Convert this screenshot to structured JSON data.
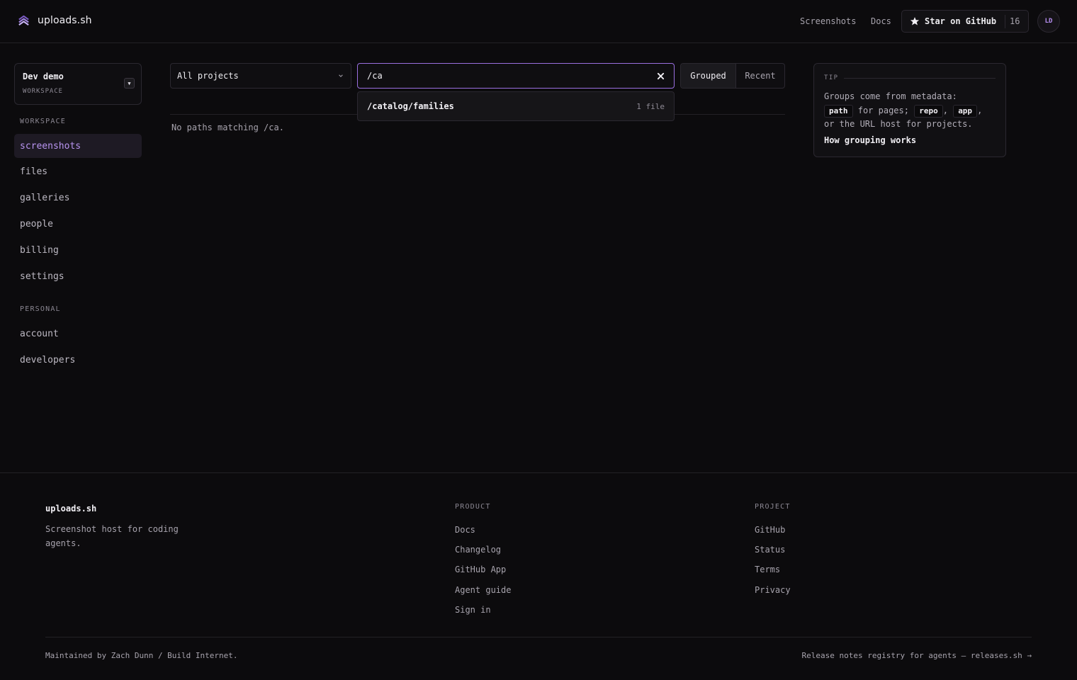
{
  "header": {
    "brand": "uploads.sh",
    "nav": {
      "screenshots": "Screenshots",
      "docs": "Docs"
    },
    "github": {
      "label": "Star on GitHub",
      "count": "16"
    },
    "avatar_initials": "LD"
  },
  "sidebar": {
    "workspace": {
      "name": "Dev demo",
      "label": "WORKSPACE"
    },
    "sections": {
      "workspace_title": "WORKSPACE",
      "personal_title": "PERSONAL"
    },
    "workspace_items": [
      {
        "label": "screenshots",
        "active": true
      },
      {
        "label": "files"
      },
      {
        "label": "galleries"
      },
      {
        "label": "people"
      },
      {
        "label": "billing"
      },
      {
        "label": "settings"
      }
    ],
    "personal_items": [
      {
        "label": "account"
      },
      {
        "label": "developers"
      }
    ]
  },
  "main": {
    "project_filter": {
      "value": "All projects"
    },
    "search": {
      "value": "/ca"
    },
    "view_toggle": {
      "grouped": "Grouped",
      "recent": "Recent",
      "selected": "Grouped"
    },
    "suggestion": {
      "path": "/catalog/families",
      "count": "1 file"
    },
    "empty_message": "No paths matching /ca."
  },
  "tip": {
    "title": "TIP",
    "text_1": "Groups come from metadata:",
    "code_path": "path",
    "text_2": "for pages;",
    "code_repo": "repo",
    "comma_1": ",",
    "code_app": "app",
    "comma_2": ",",
    "text_3": "or the URL host for projects.",
    "link": "How grouping works"
  },
  "footer": {
    "brand": "uploads.sh",
    "tagline": "Screenshot host for coding agents.",
    "product": {
      "title": "PRODUCT",
      "links": [
        "Docs",
        "Changelog",
        "GitHub App",
        "Agent guide",
        "Sign in"
      ]
    },
    "project": {
      "title": "PROJECT",
      "links": [
        "GitHub",
        "Status",
        "Terms",
        "Privacy"
      ]
    },
    "maintained": "Maintained by Zach Dunn / Build Internet.",
    "release_link": "Release notes registry for agents — releases.sh →"
  },
  "colors": {
    "background": "#0c0b0d",
    "accent": "#b894f0",
    "border": "#2b2830"
  }
}
